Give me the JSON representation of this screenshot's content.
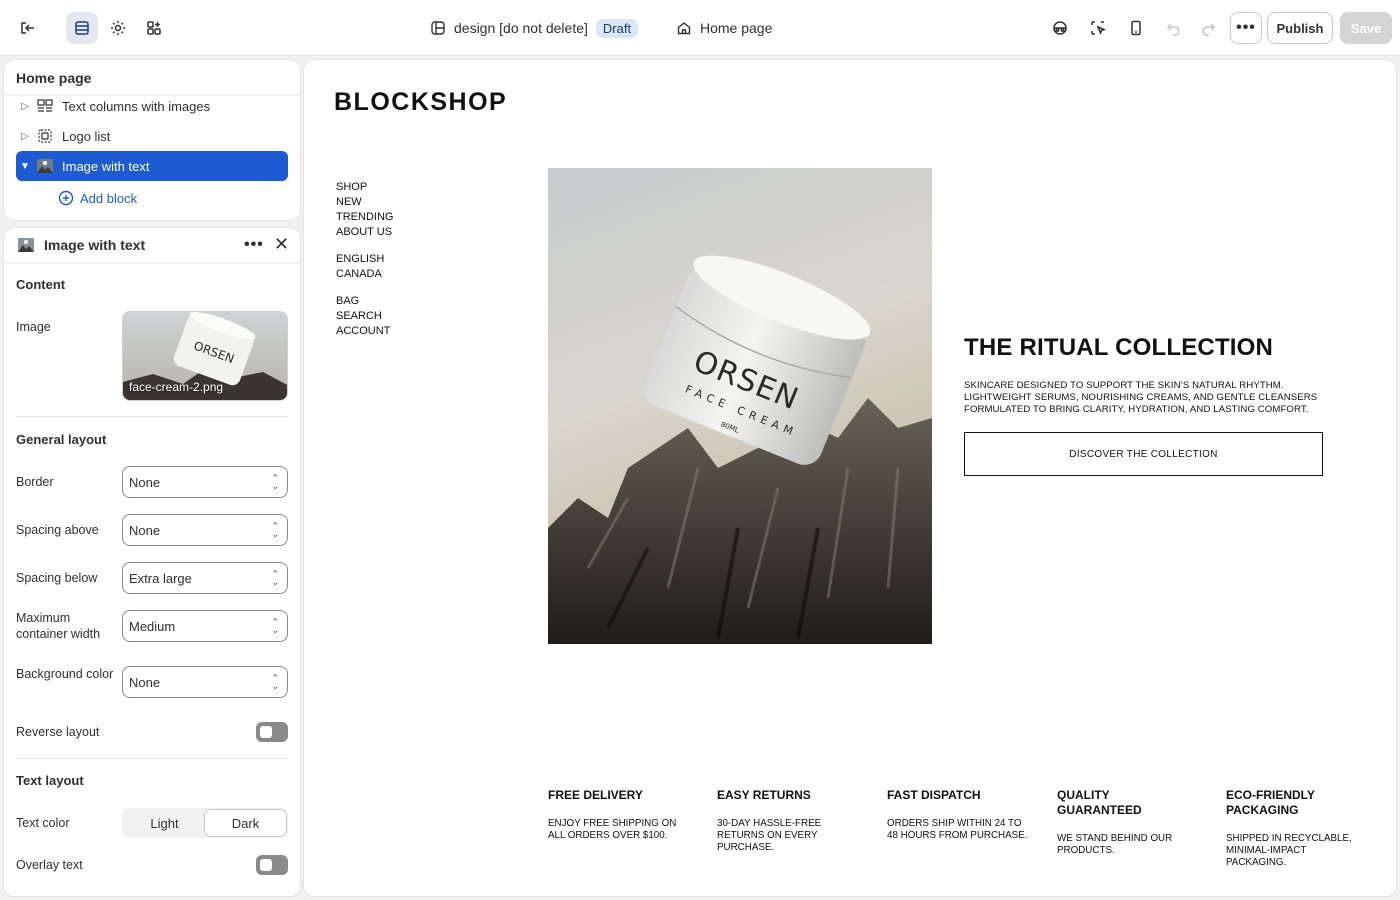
{
  "topbar": {
    "theme_name": "design [do not delete]",
    "status_badge": "Draft",
    "page_name": "Home page",
    "publish_label": "Publish",
    "save_label": "Save"
  },
  "tree": {
    "title": "Home page",
    "items": [
      {
        "label": "Text columns with images",
        "icon": "columns-icon"
      },
      {
        "label": "Logo list",
        "icon": "logo-list-icon"
      },
      {
        "label": "Image with text",
        "icon": "image-icon",
        "selected": true
      }
    ],
    "add_block_label": "Add block"
  },
  "settings": {
    "title": "Image with text",
    "content_heading": "Content",
    "image_label": "Image",
    "image_filename": "face-cream-2.png",
    "general_layout_heading": "General layout",
    "fields": [
      {
        "label": "Border",
        "value": "None"
      },
      {
        "label": "Spacing above",
        "value": "None"
      },
      {
        "label": "Spacing below",
        "value": "Extra large"
      },
      {
        "label": "Maximum container width",
        "value": "Medium"
      },
      {
        "label": "Background color",
        "value": "None"
      }
    ],
    "reverse_layout_label": "Reverse layout",
    "text_layout_heading": "Text layout",
    "text_color_label": "Text color",
    "text_color_options": [
      "Light",
      "Dark"
    ],
    "text_color_selected": "Dark",
    "overlay_text_label": "Overlay text"
  },
  "preview": {
    "logo": "BLOCKSHOP",
    "nav_main": [
      "SHOP",
      "NEW",
      "TRENDING",
      "ABOUT US"
    ],
    "nav_locale": [
      "ENGLISH",
      "CANADA"
    ],
    "nav_utility": [
      "BAG",
      "SEARCH",
      "ACCOUNT"
    ],
    "jar_brand": "ORSEN",
    "jar_product": "FACE CREAM",
    "jar_size": "80ML",
    "hero_title": "THE RITUAL COLLECTION",
    "hero_text": "SKINCARE DESIGNED TO SUPPORT THE SKIN’S NATURAL RHYTHM. LIGHTWEIGHT SERUMS, NOURISHING CREAMS, AND GENTLE CLEANSERS FORMULATED TO BRING CLARITY, HYDRATION, AND LASTING COMFORT.",
    "hero_button": "DISCOVER THE COLLECTION",
    "features": [
      {
        "title": "FREE DELIVERY",
        "desc": "ENJOY FREE SHIPPING ON ALL ORDERS OVER $100."
      },
      {
        "title": "EASY RETURNS",
        "desc": "30-DAY HASSLE-FREE RETURNS ON EVERY PURCHASE."
      },
      {
        "title": "FAST DISPATCH",
        "desc": "ORDERS SHIP WITHIN 24 TO 48 HOURS FROM PURCHASE."
      },
      {
        "title": "QUALITY GUARANTEED",
        "desc": "WE STAND BEHIND OUR PRODUCTS."
      },
      {
        "title": "ECO-FRIENDLY PACKAGING",
        "desc": "SHIPPED IN RECYCLABLE, MINIMAL-IMPACT PACKAGING."
      }
    ]
  },
  "colors": {
    "accent": "#1d5bd0",
    "badge_bg": "#d8e6f7"
  }
}
